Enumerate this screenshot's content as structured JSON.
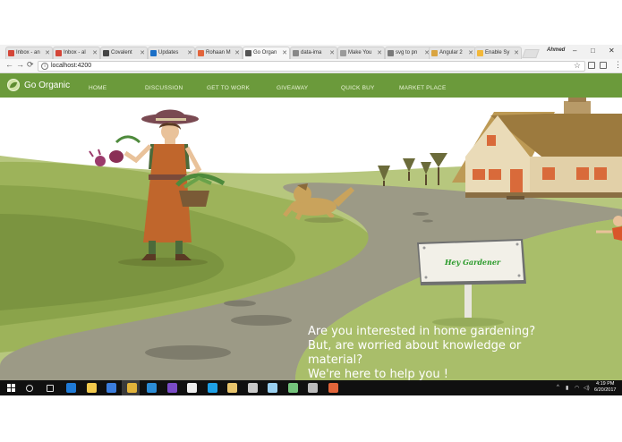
{
  "browser": {
    "tabs": [
      {
        "label": "Inbox - an",
        "favicon_color": "#d44638"
      },
      {
        "label": "Inbox - al",
        "favicon_color": "#d44638"
      },
      {
        "label": "Covalent",
        "favicon_color": "#444444"
      },
      {
        "label": "Updates",
        "favicon_color": "#1b6fc7"
      },
      {
        "label": "Rohaan M",
        "favicon_color": "#e2643b"
      },
      {
        "label": "Go Organ",
        "favicon_color": "#555555"
      },
      {
        "label": "data-ima",
        "favicon_color": "#888888"
      },
      {
        "label": "Make You",
        "favicon_color": "#9a9a9a"
      },
      {
        "label": "svg to pn",
        "favicon_color": "#7a7a7a"
      },
      {
        "label": "Angular 2",
        "favicon_color": "#d9a441"
      },
      {
        "label": "Enable Sy",
        "favicon_color": "#f3b83a"
      }
    ],
    "active_tab_index": 5,
    "profile_name": "Ahmed",
    "window_controls": {
      "minimize": "–",
      "maximize": "□",
      "close": "✕"
    },
    "nav": {
      "back": "←",
      "forward": "→",
      "reload": "⟳"
    },
    "address": {
      "url": "localhost:4200",
      "info_icon": "i",
      "star": "☆"
    },
    "menu_icon": "⋮"
  },
  "site": {
    "brand": "Go Organic",
    "nav_links": [
      "HOME",
      "DISCUSSION",
      "GET TO WORK",
      "GIVEAWAY",
      "QUICK BUY",
      "MARKET PLACE"
    ],
    "sign_text": "Hey Gardener",
    "headline": [
      "Are you interested in home gardening?",
      "But, are worried about knowledge or",
      "material?",
      "We're here to help you !"
    ]
  },
  "taskbar": {
    "pinned_apps": [
      {
        "name": "windows-start",
        "color": "#ffffff"
      },
      {
        "name": "search",
        "color": "#dddddd"
      },
      {
        "name": "task-view",
        "color": "#dddddd"
      },
      {
        "name": "edge",
        "color": "#1f7ad6"
      },
      {
        "name": "file-explorer",
        "color": "#f2c94c"
      },
      {
        "name": "store",
        "color": "#3b7ddd"
      },
      {
        "name": "chrome",
        "color": "#e2b33a"
      },
      {
        "name": "visual-studio-code",
        "color": "#2b8cd6"
      },
      {
        "name": "visual-studio",
        "color": "#7a4bc6"
      },
      {
        "name": "github",
        "color": "#eeeeee"
      },
      {
        "name": "skype",
        "color": "#1ea0e6"
      },
      {
        "name": "photos",
        "color": "#e8c46c"
      },
      {
        "name": "terminal",
        "color": "#c9c9c9"
      },
      {
        "name": "image-viewer",
        "color": "#9ad0f0"
      },
      {
        "name": "sourcetree",
        "color": "#74c37b"
      },
      {
        "name": "settings",
        "color": "#bbbbbb"
      },
      {
        "name": "chrome-2",
        "color": "#e2653a"
      }
    ],
    "tray_icons": [
      "^",
      "🔋",
      "📶",
      "🔊"
    ],
    "time": "4:19 PM",
    "date": "6/20/2017"
  }
}
